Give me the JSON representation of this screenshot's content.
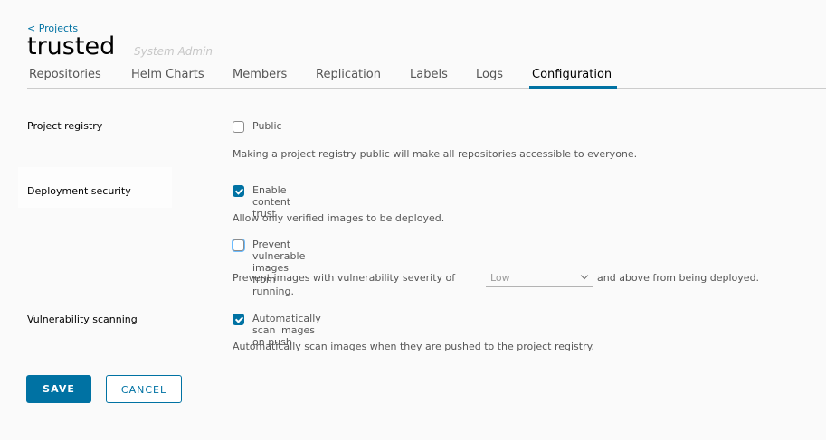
{
  "breadcrumb": {
    "back_label": "< Projects"
  },
  "project": {
    "name": "trusted",
    "role": "System Admin"
  },
  "tabs": [
    {
      "label": "Repositories"
    },
    {
      "label": "Helm Charts"
    },
    {
      "label": "Members"
    },
    {
      "label": "Replication"
    },
    {
      "label": "Labels"
    },
    {
      "label": "Logs"
    },
    {
      "label": "Configuration",
      "active": true
    }
  ],
  "config": {
    "project_registry": {
      "label": "Project registry",
      "public_label": "Public",
      "public_checked": false,
      "help": "Making a project registry public will make all repositories accessible to everyone."
    },
    "deployment_security": {
      "label": "Deployment security",
      "content_trust_label": "Enable content trust",
      "content_trust_checked": true,
      "content_trust_help": "Allow only verified images to be deployed.",
      "prevent_vuln_label": "Prevent vulnerable images from running.",
      "prevent_vuln_checked": false,
      "severity_prefix": "Prevent images with vulnerability severity of",
      "severity_value": "Low",
      "severity_suffix": "and above from being deployed."
    },
    "vulnerability_scanning": {
      "label": "Vulnerability scanning",
      "auto_scan_label": "Automatically scan images on push",
      "auto_scan_checked": true,
      "help": "Automatically scan images when they are pushed to the project registry."
    }
  },
  "actions": {
    "save_label": "SAVE",
    "cancel_label": "CANCEL"
  },
  "colors": {
    "accent": "#0072a3"
  }
}
